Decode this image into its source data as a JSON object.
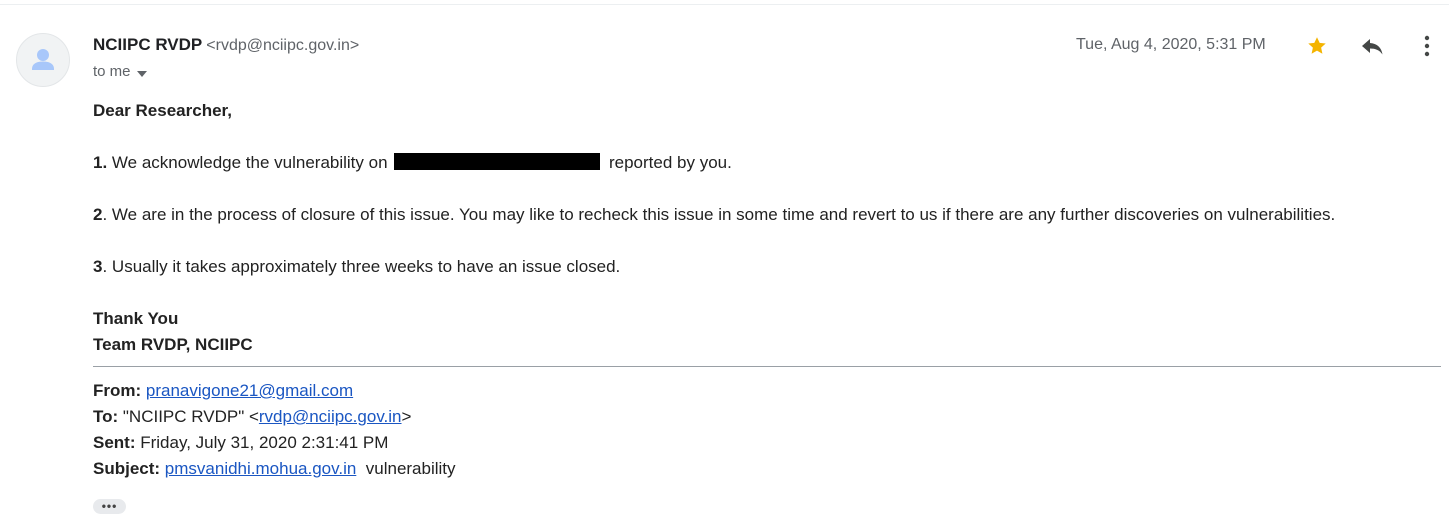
{
  "header": {
    "sender_name": "NCIIPC RVDP",
    "sender_email": "<rvdp@nciipc.gov.in>",
    "to_label": "to me",
    "date": "Tue, Aug 4, 2020, 5:31 PM",
    "star_color": "#f4b400"
  },
  "body": {
    "greeting": "Dear Researcher,",
    "item1_num": "1.",
    "item1_before": " We acknowledge the vulnerability on ",
    "item1_after": " reported by you.",
    "item2_num": "2",
    "item2_text": ". We are in the process of closure of this issue. You may like to recheck this issue in some time and revert to us if there are any further discoveries on vulnerabilities.",
    "item3_num": "3",
    "item3_text": ". Usually it takes approximately three weeks to have an issue closed.",
    "signoff1": "Thank You",
    "signoff2": "Team RVDP, NCIIPC"
  },
  "quoted": {
    "from_label": "From:",
    "from_value": "pranavigone21@gmail.com",
    "to_label": "To:",
    "to_prefix": " \"NCIIPC RVDP\" <",
    "to_email": "rvdp@nciipc.gov.in",
    "to_suffix": ">",
    "sent_label": "Sent:",
    "sent_value": " Friday, July 31, 2020 2:31:41 PM",
    "subject_label": "Subject:",
    "subject_link": "pmsvanidhi.mohua.gov.in",
    "subject_rest": "  vulnerability"
  },
  "ellipsis_label": "•••",
  "icons": {
    "avatar": "person-icon",
    "star": "star-icon",
    "reply": "reply-icon",
    "more": "more-vert-icon",
    "caret": "caret-down-icon"
  }
}
